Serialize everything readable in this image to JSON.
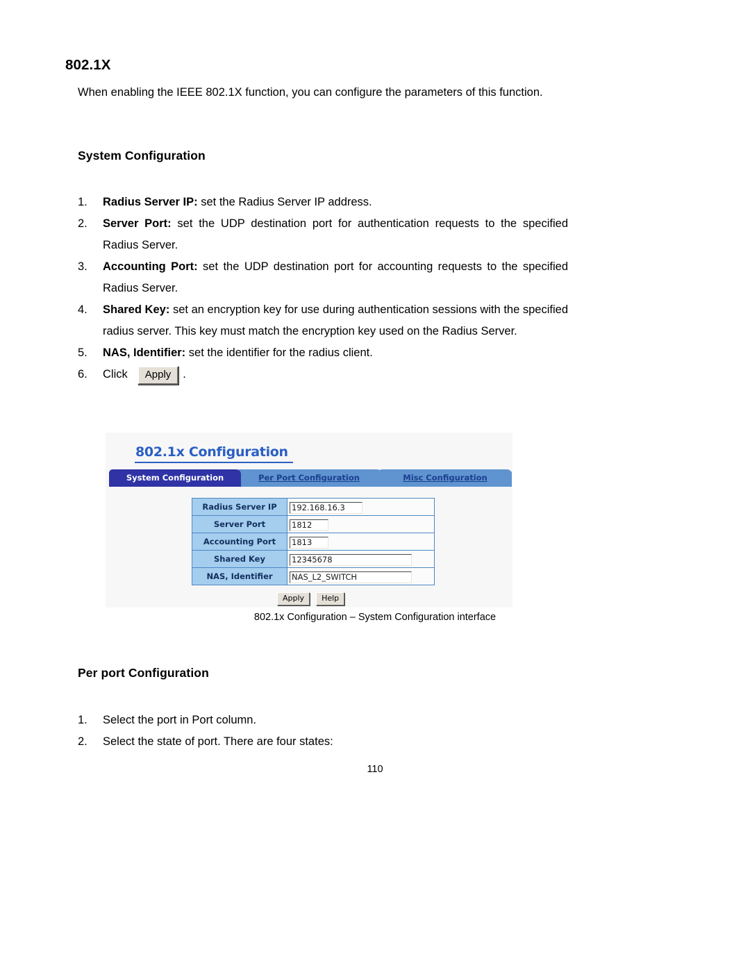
{
  "document": {
    "heading": "802.1X",
    "intro": "When enabling the IEEE 802.1X function, you can configure the parameters of this function.",
    "section_system": "System Configuration",
    "section_per_port": "Per port Configuration",
    "page_number": "110",
    "figure_caption": "802.1x Configuration – System Configuration interface",
    "system_steps": [
      {
        "num": "1.",
        "term": "Radius Server IP:",
        "text": " set the Radius Server IP address."
      },
      {
        "num": "2.",
        "term": "Server Port:",
        "text": " set the UDP destination port for authentication requests to the specified Radius Server."
      },
      {
        "num": "3.",
        "term": "Accounting Port:",
        "text": " set the UDP destination port for accounting requests to the specified Radius Server."
      },
      {
        "num": "4.",
        "term": "Shared Key:",
        "text": " set an encryption key for use during authentication sessions with the specified radius server. This key must match the encryption key used on the Radius Server."
      },
      {
        "num": "5.",
        "term": "NAS, Identifier:",
        "text": " set the identifier for the radius client."
      }
    ],
    "step_click": {
      "num": "6.",
      "prefix": "Click",
      "button_label": "Apply",
      "suffix": "."
    },
    "per_port_steps": [
      {
        "num": "1.",
        "text": "Select the port in Port column."
      },
      {
        "num": "2.",
        "text": "Select the state of port. There are four states:"
      }
    ]
  },
  "screenshot": {
    "title": "802.1x Configuration",
    "tabs": [
      {
        "label": "System Configuration",
        "active": true
      },
      {
        "label": "Per Port Configuration",
        "active": false
      },
      {
        "label": "Misc Configuration",
        "active": false
      }
    ],
    "form_rows": [
      {
        "label": "Radius Server IP",
        "value": "192.168.16.3"
      },
      {
        "label": "Server Port",
        "value": "1812"
      },
      {
        "label": "Accounting Port",
        "value": "1813"
      },
      {
        "label": "Shared Key",
        "value": "12345678"
      },
      {
        "label": "NAS, Identifier",
        "value": "NAS_L2_SWITCH"
      }
    ],
    "buttons": [
      {
        "label": "Apply"
      },
      {
        "label": "Help"
      }
    ],
    "colors": {
      "title_blue": "#2a5fc4",
      "active_tab": "#2f33a5",
      "inactive_tab": "#5f94d0",
      "label_cell": "#a4cdee",
      "table_border": "#4f87c4",
      "panel_bg": "#f7f7f7"
    }
  }
}
